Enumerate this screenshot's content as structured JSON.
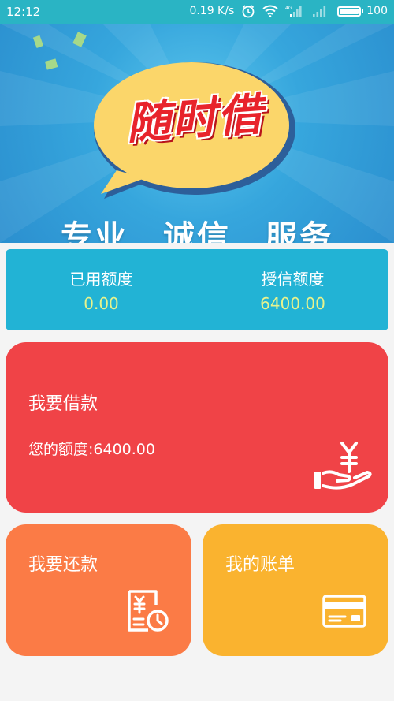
{
  "status_bar": {
    "time": "12:12",
    "speed": "0.19 K/s",
    "network": "4G",
    "battery": "100"
  },
  "banner": {
    "logo": "随时借",
    "slogan": [
      "专业",
      "诚信",
      "服务"
    ]
  },
  "quota": {
    "used_label": "已用额度",
    "used_value": "0.00",
    "credit_label": "授信额度",
    "credit_value": "6400.00"
  },
  "borrow": {
    "title": "我要借款",
    "limit_text": "您的额度:6400.00",
    "icon": "hand-yuan-icon"
  },
  "repay": {
    "title": "我要还款",
    "icon": "repay-bill-icon"
  },
  "bill": {
    "title": "我的账单",
    "icon": "bank-card-icon"
  },
  "colors": {
    "status_bar": "#2ab4c4",
    "quota_card": "#22b3d5",
    "quota_value": "#e8f38c",
    "borrow_card": "#f04347",
    "repay_card": "#fb7b46",
    "bill_card": "#fab32f",
    "logo_red": "#e8232b",
    "bubble_yellow": "#fbd66a"
  }
}
